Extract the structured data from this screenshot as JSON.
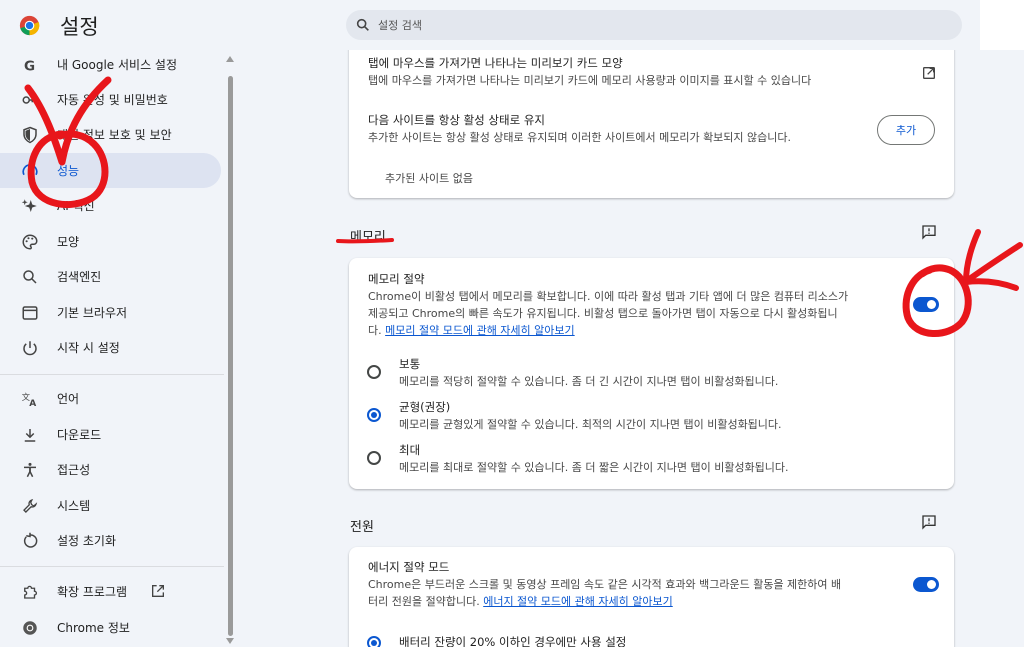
{
  "app": {
    "title": "설정"
  },
  "search": {
    "placeholder": "설정 검색"
  },
  "sidebar": {
    "items": [
      {
        "label": "내 Google 서비스 설정",
        "icon": "google-g-icon"
      },
      {
        "label": "자동 완성 및 비밀번호",
        "icon": "key-icon"
      },
      {
        "label": "개인 정보 보호 및 보안",
        "icon": "shield-icon"
      },
      {
        "label": "성능",
        "icon": "speedometer-icon",
        "active": true
      },
      {
        "label": "AI 혁신",
        "icon": "sparkle-icon"
      },
      {
        "label": "모양",
        "icon": "palette-icon"
      },
      {
        "label": "검색엔진",
        "icon": "search-icon"
      },
      {
        "label": "기본 브라우저",
        "icon": "browser-window-icon"
      },
      {
        "label": "시작 시 설정",
        "icon": "power-icon"
      },
      {
        "label": "언어",
        "icon": "translate-icon"
      },
      {
        "label": "다운로드",
        "icon": "download-icon"
      },
      {
        "label": "접근성",
        "icon": "accessibility-icon"
      },
      {
        "label": "시스템",
        "icon": "wrench-icon"
      },
      {
        "label": "설정 초기화",
        "icon": "reset-icon"
      },
      {
        "label": "확장 프로그램",
        "icon": "puzzle-icon"
      },
      {
        "label": "Chrome 정보",
        "icon": "chrome-icon"
      }
    ]
  },
  "tabs_card": {
    "hover_title": "탭에 마우스를 가져가면 나타나는 미리보기 카드 모양",
    "hover_desc": "탭에 마우스를 가져가면 나타나는 미리보기 카드에 메모리 사용량과 이미지를 표시할 수 있습니다",
    "active_title": "다음 사이트를 항상 활성 상태로 유지",
    "active_desc": "추가한 사이트는 항상 활성 상태로 유지되며 이러한 사이트에서 메모리가 확보되지 않습니다.",
    "add_button": "추가",
    "empty_text": "추가된 사이트 없음"
  },
  "memory": {
    "section_title": "메모리",
    "saver_title": "메모리 절약",
    "saver_desc_1": "Chrome이 비활성 탭에서 메모리를 확보합니다. 이에 따라 활성 탭과 기타 앱에 더 많은 컴퓨터 리소스가",
    "saver_desc_2": "제공되고 Chrome의 빠른 속도가 유지됩니다. 비활성 탭으로 돌아가면 탭이 자동으로 다시 활성화됩니",
    "saver_desc_3": "다.",
    "saver_link": "메모리 절약 모드에 관해 자세히 알아보기",
    "saver_enabled": true,
    "options": [
      {
        "title": "보통",
        "desc": "메모리를 적당히 절약할 수 있습니다. 좀 더 긴 시간이 지나면 탭이 비활성화됩니다.",
        "checked": false
      },
      {
        "title": "균형(권장)",
        "desc": "메모리를 균형있게 절약할 수 있습니다. 최적의 시간이 지나면 탭이 비활성화됩니다.",
        "checked": true
      },
      {
        "title": "최대",
        "desc": "메모리를 최대로 절약할 수 있습니다. 좀 더 짧은 시간이 지나면 탭이 비활성화됩니다.",
        "checked": false
      }
    ]
  },
  "power": {
    "section_title": "전원",
    "energy_title": "에너지 절약 모드",
    "energy_desc_1": "Chrome은 부드러운 스크롤 및 동영상 프레임 속도 같은 시각적 효과와 백그라운드 활동을 제한하여 배",
    "energy_desc_2": "터리 전원을 절약합니다.",
    "energy_link": "에너지 절약 모드에 관해 자세히 알아보기",
    "energy_enabled": true,
    "battery_option": "배터리 잔량이 20% 이하인 경우에만 사용 설정"
  },
  "colors": {
    "accent": "#0b57d0",
    "annotation": "#e8161b",
    "active_nav_bg": "#dde3f1"
  }
}
